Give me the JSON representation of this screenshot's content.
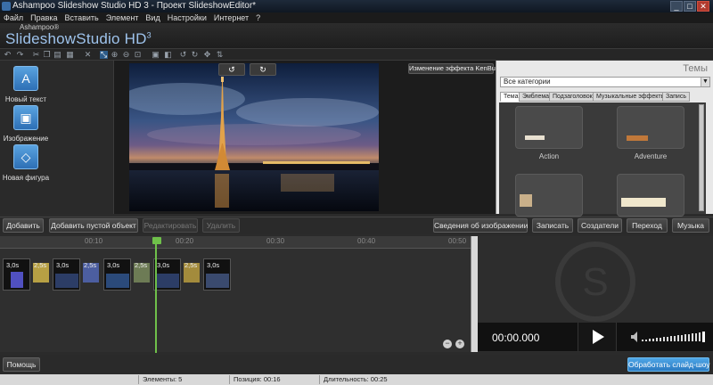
{
  "window": {
    "title": "Ashampoo Slideshow Studio HD 3 - Проект SlideshowEditor*",
    "minimize": "_",
    "maximize": "□",
    "close": "✕"
  },
  "menu": [
    "Файл",
    "Правка",
    "Вставить",
    "Элемент",
    "Вид",
    "Настройки",
    "Интернет",
    "?"
  ],
  "brand": {
    "small": "Ashampoo®",
    "name": "SlideshowStudio HD",
    "version": "3"
  },
  "palette": [
    {
      "label": "Новый текст",
      "icon": "text-icon",
      "glyph": "A"
    },
    {
      "label": "Изображение",
      "icon": "image-icon",
      "glyph": "▣"
    },
    {
      "label": "Новая фигура",
      "icon": "shape-icon",
      "glyph": "◇"
    }
  ],
  "preview": {
    "kenburns_label": "Изменение эффекта KenBurns",
    "rotate_left": "↺",
    "rotate_right": "↻"
  },
  "themes": {
    "header": "Темы",
    "category": "Все категории",
    "tabs": [
      "Тема",
      "Эмблема",
      "Подзаголовок",
      "Музыкальные эффекты",
      "Запись"
    ],
    "active_tab": "Тема",
    "items": [
      "Action",
      "Adventure"
    ]
  },
  "actions": {
    "add": "Добавить",
    "add_empty": "Добавить пустой объект",
    "edit": "Редактировать",
    "delete": "Удалить",
    "image_info": "Сведения об изображении",
    "record": "Записать",
    "creators": "Создатели",
    "transition": "Переход",
    "music": "Музыка"
  },
  "timeline": {
    "ticks": [
      "00:10",
      "00:20",
      "00:30",
      "00:40",
      "00:50"
    ],
    "slides": [
      "3,0s",
      "3,0s",
      "3,0s",
      "3,0s",
      "3,0s"
    ],
    "transitions": [
      "2,5s",
      "2,5s",
      "2,5s",
      "2,5s"
    ],
    "zoom_out": "−",
    "zoom_in": "+"
  },
  "player": {
    "timecode": "00:00.000"
  },
  "footer": {
    "help": "Помощь",
    "process": "Обработать слайд-шоу"
  },
  "status": {
    "elements": "Элементы: 5",
    "position": "Позиция: 00:16",
    "duration": "Длительность: 00:25"
  }
}
